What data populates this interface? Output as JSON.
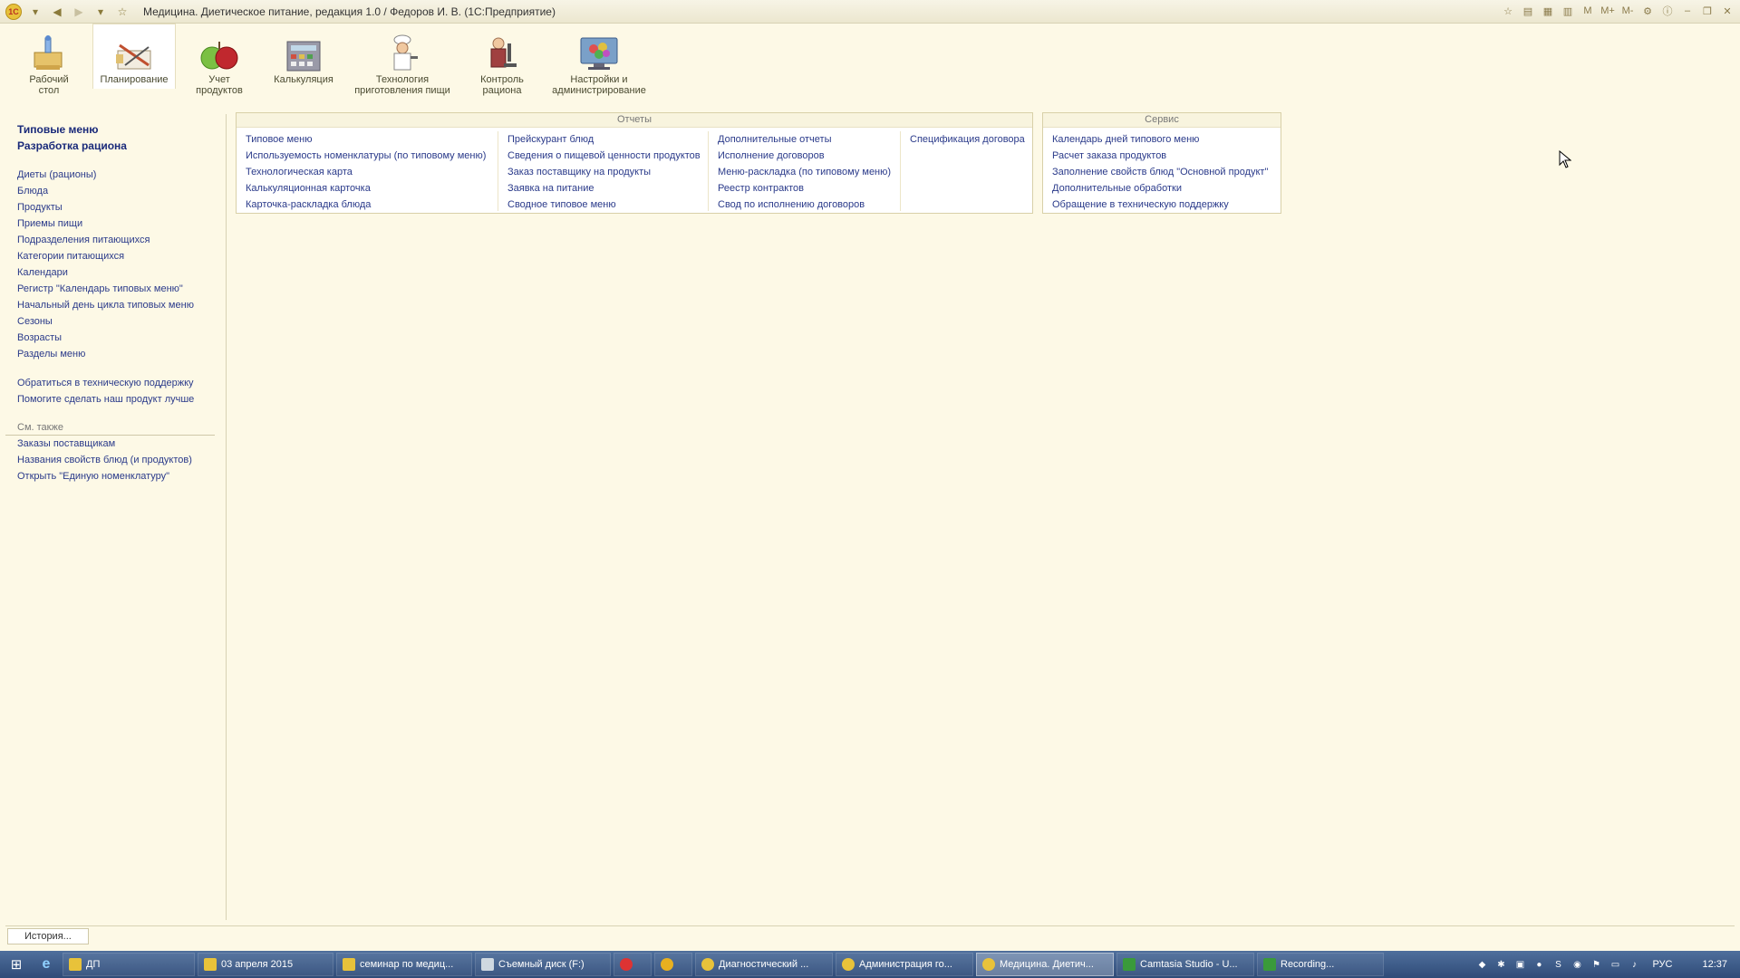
{
  "window": {
    "title": "Медицина. Диетическое питание, редакция 1.0 / Федоров И. В. (1С:Предприятие)"
  },
  "sections": [
    {
      "label": "Рабочий\nстол",
      "icon": "desktop-icon"
    },
    {
      "label": "Планирование",
      "icon": "planning-icon"
    },
    {
      "label": "Учет\nпродуктов",
      "icon": "apple-icon"
    },
    {
      "label": "Калькуляция",
      "icon": "calculation-icon"
    },
    {
      "label": "Технология\nприготовления пищи",
      "icon": "chef-icon"
    },
    {
      "label": "Контроль\nрациона",
      "icon": "microscope-icon"
    },
    {
      "label": "Настройки и\nадминистрирование",
      "icon": "settings-monitor-icon"
    }
  ],
  "leftnav": {
    "bold_items": [
      "Типовые меню",
      "Разработка рациона"
    ],
    "items": [
      "Диеты (рационы)",
      "Блюда",
      "Продукты",
      "Приемы пищи",
      "Подразделения питающихся",
      "Категории питающихся",
      "Календари",
      "Регистр \"Календарь типовых меню\"",
      "Начальный день цикла типовых меню",
      "Сезоны",
      "Возрасты",
      "Разделы меню"
    ],
    "support_items": [
      "Обратиться в техническую поддержку",
      "Помогите сделать наш продукт лучше"
    ],
    "see_also_label": "См. также",
    "see_also_items": [
      "Заказы поставщикам",
      "Названия свойств блюд (и продуктов)",
      "Открыть \"Единую номенклатуру\""
    ]
  },
  "reports": {
    "title": "Отчеты",
    "columns": [
      [
        "Типовое меню",
        "Используемость номенклатуры (по типовому меню)",
        "Технологическая карта",
        "Калькуляционная карточка",
        "Карточка-раскладка блюда"
      ],
      [
        "Прейскурант блюд",
        "Сведения о пищевой ценности продуктов",
        "Заказ поставщику на продукты",
        "Заявка на питание",
        "Сводное типовое меню"
      ],
      [
        "Дополнительные отчеты",
        "Исполнение договоров",
        "Меню-раскладка (по типовому меню)",
        "Реестр контрактов",
        "Свод по исполнению договоров"
      ],
      [
        "Спецификация договора"
      ]
    ]
  },
  "service": {
    "title": "Сервис",
    "items": [
      "Календарь дней типового меню",
      "Расчет заказа продуктов",
      "Заполнение свойств блюд \"Основной продукт\"",
      "Дополнительные обработки",
      "Обращение в техническую поддержку"
    ]
  },
  "history_button": "История...",
  "taskbar": {
    "tasks": [
      {
        "label": "ДП",
        "icon": "folder-icon",
        "color": "#e8c23a"
      },
      {
        "label": "03 апреля 2015",
        "icon": "folder-icon",
        "color": "#e8c23a"
      },
      {
        "label": "семинар по медиц...",
        "icon": "folder-icon",
        "color": "#e8c23a"
      },
      {
        "label": "Съемный диск (F:)",
        "icon": "drive-icon",
        "color": "#cfd8e0"
      },
      {
        "label": "",
        "icon": "opera-icon",
        "color": "#d33"
      },
      {
        "label": "",
        "icon": "chrome-icon",
        "color": "#e8b020"
      },
      {
        "label": "Диагностический ...",
        "icon": "1c-icon",
        "color": "#e8c23a"
      },
      {
        "label": "Администрация го...",
        "icon": "1c-icon",
        "color": "#e8c23a"
      },
      {
        "label": "Медицина. Диетич...",
        "icon": "1c-icon",
        "color": "#e8c23a"
      },
      {
        "label": "Camtasia Studio - U...",
        "icon": "camtasia-icon",
        "color": "#3a9a3a"
      },
      {
        "label": "Recording...",
        "icon": "camtasia-icon",
        "color": "#3a9a3a"
      }
    ],
    "language": "РУС",
    "clock": "12:37"
  }
}
